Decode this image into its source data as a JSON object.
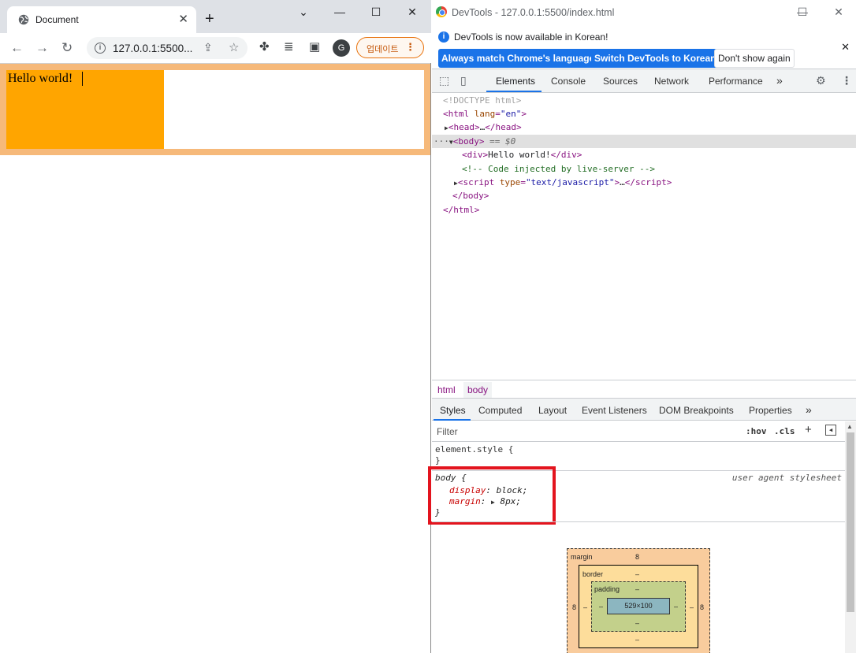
{
  "browser": {
    "tab_title": "Document",
    "tab_close": "✕",
    "new_tab": "+",
    "window_controls": {
      "dropdown": "⌄",
      "minimize": "—",
      "maximize": "☐",
      "close": "✕"
    },
    "url": "127.0.0.1:5500...",
    "avatar_letter": "G",
    "update_label": "업데이트",
    "page_text": "Hello world!"
  },
  "devtools": {
    "window_title": "DevTools - 127.0.0.1:5500/index.html",
    "window_controls": {
      "minimize": "—",
      "maximize": "☐",
      "close": "✕"
    },
    "infobar": {
      "message": "DevTools is now available in Korean!",
      "btn_match": "Always match Chrome's language",
      "btn_switch": "Switch DevTools to Korean",
      "btn_dismiss": "Don't show again"
    },
    "tabs": [
      "Elements",
      "Console",
      "Sources",
      "Network",
      "Performance"
    ],
    "more_tabs": "»",
    "dom": {
      "doctype": "<!DOCTYPE html>",
      "html_open_tag": "html",
      "html_attr_name": "lang",
      "html_attr_value": "\"en\"",
      "head_collapsed": "…",
      "body_tag": "body",
      "body_marker": "== $0",
      "div_text": "Hello world!",
      "comment": "<!-- Code injected by live-server -->",
      "script_attr_name": "type",
      "script_attr_value": "\"text/javascript\"",
      "script_collapsed": "…"
    },
    "breadcrumbs": [
      "html",
      "body"
    ],
    "styles_tabs": [
      "Styles",
      "Computed",
      "Layout",
      "Event Listeners",
      "DOM Breakpoints",
      "Properties"
    ],
    "filter_placeholder": "Filter",
    "filter_buttons": {
      "hov": ":hov",
      "cls": ".cls",
      "plus": "+"
    },
    "styles": {
      "element_style": "element.style {",
      "close_brace": "}",
      "body_selector": "body {",
      "source": "user agent stylesheet",
      "prop1_name": "display",
      "prop1_value": "block;",
      "prop2_name": "margin",
      "prop2_value": "8px;"
    },
    "box_model": {
      "margin_label": "margin",
      "margin_top": "8",
      "margin_left": "8",
      "margin_right": "8",
      "border_label": "border",
      "border_top": "–",
      "border_bottom": "–",
      "border_left": "–",
      "border_right": "–",
      "padding_label": "padding",
      "padding_top": "–",
      "padding_bottom": "–",
      "padding_left": "–",
      "padding_right": "–",
      "content": "529×100"
    }
  }
}
